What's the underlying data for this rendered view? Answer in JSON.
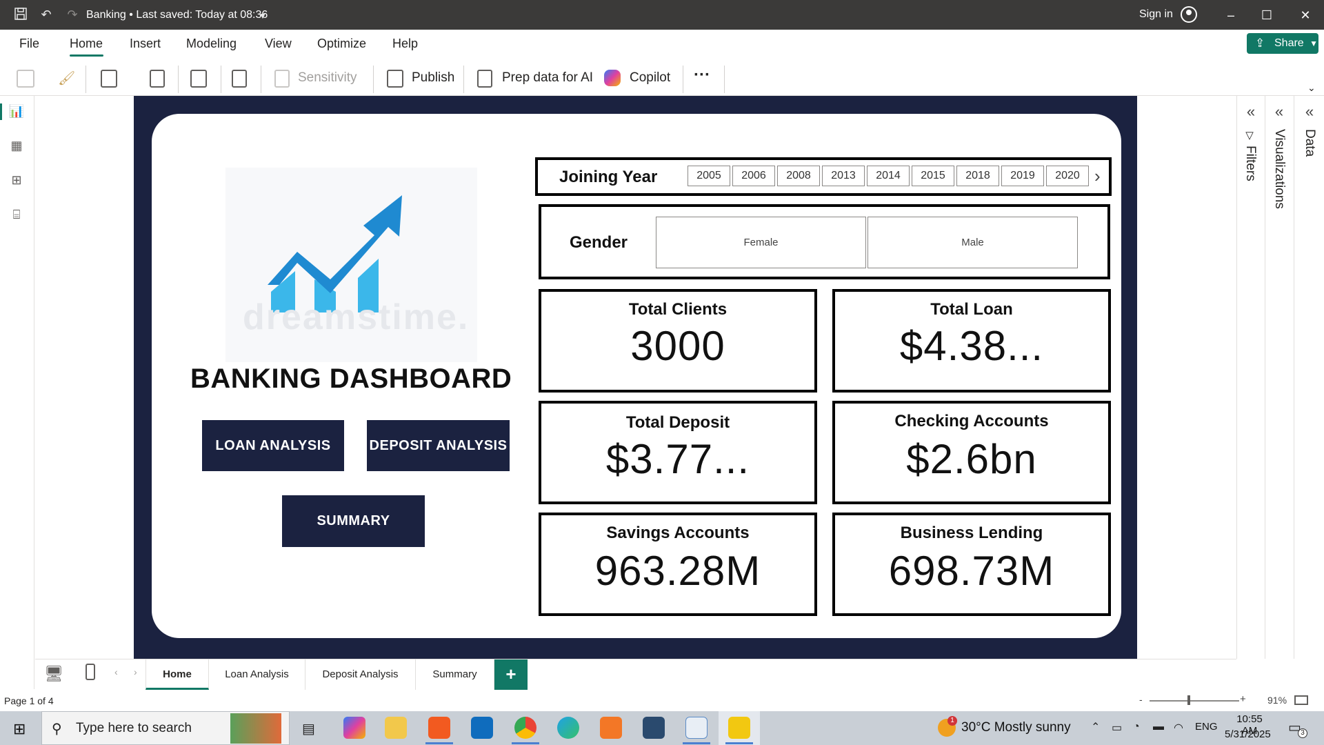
{
  "app": {
    "title": "Banking  •  Last saved: Today at 08:36",
    "sign_in": "Sign in"
  },
  "menu": {
    "items": [
      "File",
      "Home",
      "Insert",
      "Modeling",
      "View",
      "Optimize",
      "Help"
    ],
    "share": "Share"
  },
  "ribbon": {
    "sensitivity": "Sensitivity",
    "publish": "Publish",
    "prep_data": "Prep data for AI",
    "copilot": "Copilot",
    "more": "···"
  },
  "report": {
    "title": "BANKING DASHBOARD",
    "watermark": "dreamstime.",
    "buttons": {
      "loan": "LOAN ANALYSIS",
      "deposit": "DEPOSIT ANALYSIS",
      "summary": "SUMMARY"
    },
    "joining_year": {
      "label": "Joining Year",
      "years": [
        "2005",
        "2006",
        "2008",
        "2013",
        "2014",
        "2015",
        "2018",
        "2019",
        "2020"
      ]
    },
    "gender": {
      "label": "Gender",
      "options": [
        "Female",
        "Male"
      ]
    },
    "kpis": [
      {
        "title": "Total Clients",
        "value": "3000"
      },
      {
        "title": "Total Loan",
        "value": "$4.38..."
      },
      {
        "title": "Total Deposit",
        "value": "$3.77..."
      },
      {
        "title": "Checking Accounts",
        "value": "$2.6bn"
      },
      {
        "title": "Savings Accounts",
        "value": "963.28M"
      },
      {
        "title": "Business Lending",
        "value": "698.73M"
      }
    ]
  },
  "panes": {
    "filters": "Filters",
    "visualizations": "Visualizations",
    "data": "Data"
  },
  "tabs": [
    "Home",
    "Loan Analysis",
    "Deposit Analysis",
    "Summary"
  ],
  "status": {
    "page": "Page 1 of 4",
    "zoom": "91%",
    "zoom_minus": "-",
    "zoom_plus": "+"
  },
  "taskbar": {
    "search_placeholder": "Type here to search",
    "weather": "30°C  Mostly sunny",
    "lang": "ENG",
    "time": "10:55 AM",
    "date": "5/31/2025",
    "weather_badge": "1",
    "notif_badge": "3"
  },
  "colors": {
    "accent": "#117865",
    "navy": "#1b2240",
    "logo_blue": "#1f8ad1",
    "logo_light": "#3bb7ea"
  }
}
